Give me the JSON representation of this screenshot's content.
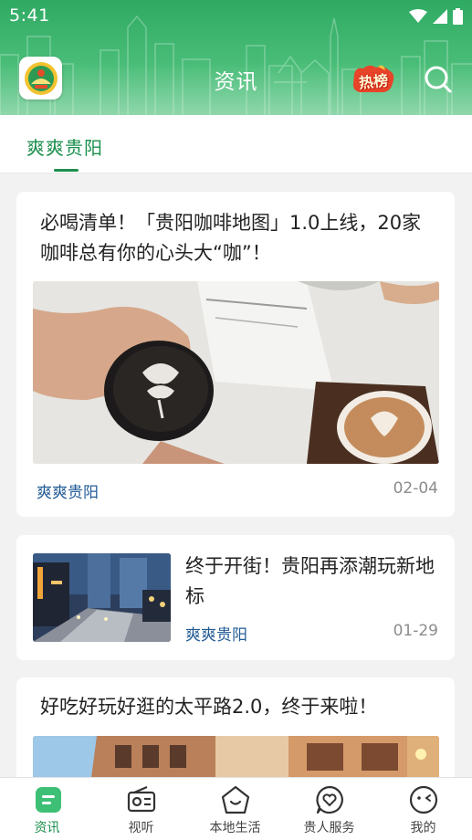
{
  "status_bar": {
    "time": "5:41"
  },
  "header": {
    "title": "资讯",
    "hot_badge": "热榜",
    "icons": {
      "logo": "app-logo-icon",
      "search": "search-icon"
    }
  },
  "tabs": [
    {
      "label": "爽爽贵阳",
      "active": true
    }
  ],
  "articles": [
    {
      "title": "必喝清单！「贵阳咖啡地图」1.0上线，20家咖啡总有你的心头大“咖”！",
      "source": "爽爽贵阳",
      "date": "02-04",
      "image": "latte-art-coffee-photo",
      "layout": "large-image"
    },
    {
      "title": "终于开街！贵阳再添潮玩新地标",
      "source": "爽爽贵阳",
      "date": "01-29",
      "image": "night-street-photo",
      "layout": "thumbnail-left"
    },
    {
      "title": "好吃好玩好逛的太平路2.0，终于来啦！",
      "image": "street-building-photo",
      "layout": "large-image"
    }
  ],
  "bottom_nav": [
    {
      "label": "资讯",
      "icon": "news-icon",
      "active": true
    },
    {
      "label": "视听",
      "icon": "radio-icon",
      "active": false
    },
    {
      "label": "本地生活",
      "icon": "local-life-icon",
      "active": false
    },
    {
      "label": "贵人服务",
      "icon": "heart-service-icon",
      "active": false
    },
    {
      "label": "我的",
      "icon": "profile-face-icon",
      "active": false
    }
  ],
  "colors": {
    "brand_green": "#1b8f4d",
    "header_green": "#2faa63",
    "source_blue": "#245c96",
    "hot_red": "#e8442a"
  }
}
